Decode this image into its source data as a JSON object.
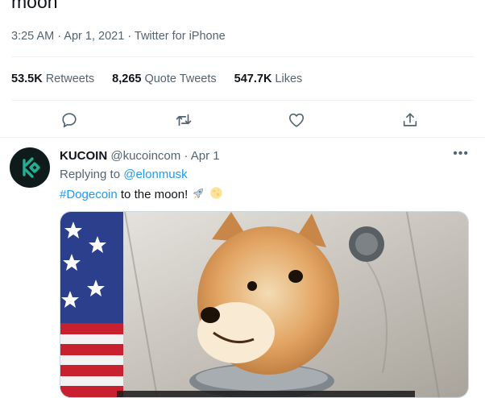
{
  "tweet": {
    "text": "moon",
    "timestamp": "3:25 AM · Apr 1, 2021",
    "source": "Twitter for iPhone"
  },
  "stats": {
    "retweets_count": "53.5K",
    "retweets_label": "Retweets",
    "quotes_count": "8,265",
    "quotes_label": "Quote Tweets",
    "likes_count": "547.7K",
    "likes_label": "Likes"
  },
  "actions": [
    "reply-icon",
    "retweet-icon",
    "like-icon",
    "share-icon"
  ],
  "reply": {
    "display_name": "KUCOIN",
    "handle": "@kucoincom",
    "date": "Apr 1",
    "replying_to_label": "Replying to",
    "replying_to": "@elonmusk",
    "hashtag": "#Dogecoin",
    "text_after": "to the moon!",
    "emojis": [
      "rocket",
      "full-moon"
    ],
    "avatar_color": "#23af91"
  },
  "colors": {
    "link": "#1d9bf0",
    "secondary_text": "#536471",
    "divider": "#eff3f4"
  }
}
